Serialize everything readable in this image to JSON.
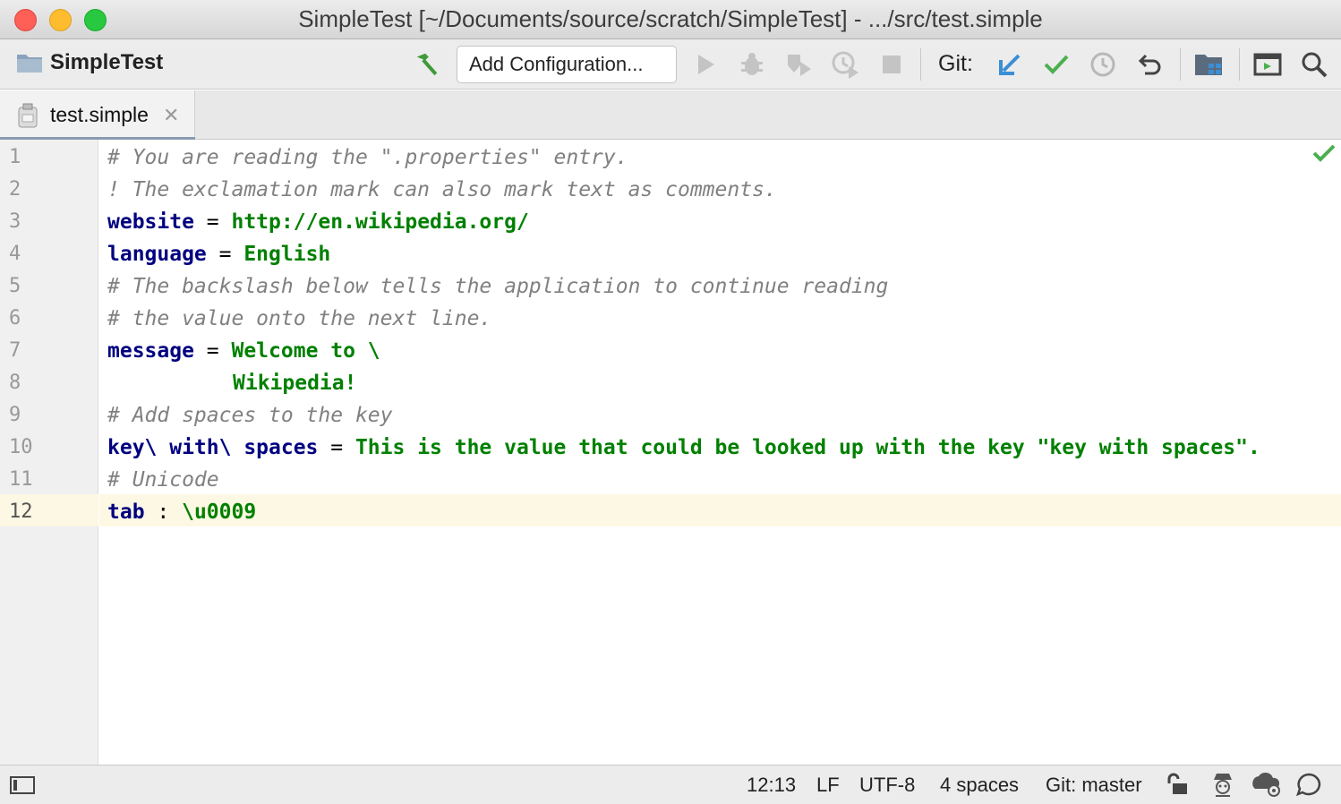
{
  "window": {
    "title": "SimpleTest [~/Documents/source/scratch/SimpleTest] - .../src/test.simple"
  },
  "toolbar": {
    "project_name": "SimpleTest",
    "add_configuration_label": "Add Configuration...",
    "git_label": "Git:"
  },
  "tabs": [
    {
      "label": "test.simple",
      "icon": "file-icon",
      "active": true
    }
  ],
  "editor": {
    "line_numbers": [
      "1",
      "2",
      "3",
      "4",
      "5",
      "6",
      "7",
      "8",
      "9",
      "10",
      "11",
      "12"
    ],
    "current_line": 12,
    "lines": [
      {
        "comment": "# You are reading the \".properties\" entry."
      },
      {
        "comment": "! The exclamation mark can also mark text as comments."
      },
      {
        "key": "website",
        "op": " = ",
        "value": "http://en.wikipedia.org/"
      },
      {
        "key": "language",
        "op": " = ",
        "value": "English"
      },
      {
        "comment": "# The backslash below tells the application to continue reading"
      },
      {
        "comment": "# the value onto the next line."
      },
      {
        "key": "message",
        "op": " = ",
        "value": "Welcome to \\"
      },
      {
        "value": "Wikipedia!"
      },
      {
        "comment": "# Add spaces to the key"
      },
      {
        "key": "key\\ with\\ spaces",
        "op": " = ",
        "value": "This is the value that could be looked up with the key \"key with spaces\"."
      },
      {
        "comment": "# Unicode"
      },
      {
        "key": "tab",
        "op": " : ",
        "value": "\\u0009"
      }
    ]
  },
  "statusbar": {
    "position": "12:13",
    "line_separator": "LF",
    "encoding": "UTF-8",
    "indent": "4 spaces",
    "git_branch": "Git: master"
  },
  "colors": {
    "key": "#000080",
    "value": "#008000",
    "comment": "#808080",
    "current_line": "#fdf8e3",
    "git_update": "#3b8fd6",
    "git_commit": "#4caf50"
  }
}
